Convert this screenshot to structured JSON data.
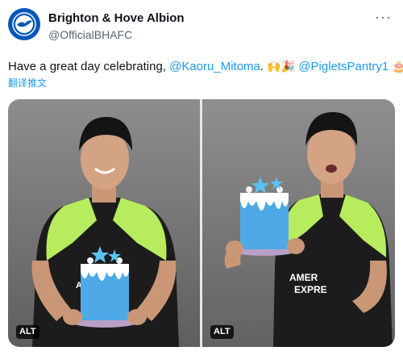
{
  "account": {
    "name": "Brighton & Hove Albion",
    "handle": "@OfficialBHAFC",
    "avatar_icon": "club-crest-icon"
  },
  "more_icon": "more-options-icon",
  "tweet": {
    "text_prefix": "Have a great day celebrating, ",
    "mention1": "@Kaoru_Mitoma",
    "separator1": ".",
    "emoji1": "🙌🎉",
    "separator2": " ",
    "mention2": "@PigletsPantry1",
    "emoji2": "🎂",
    "translate_label": "翻译推文"
  },
  "media": [
    {
      "alt_label": "ALT",
      "description_icon": "photo"
    },
    {
      "alt_label": "ALT",
      "description_icon": "photo"
    }
  ],
  "colors": {
    "accent": "#1d9bf0",
    "brand_blue": "#0057b8",
    "shirt_green": "#b6ec5e",
    "cake_blue": "#4fa9e6"
  }
}
